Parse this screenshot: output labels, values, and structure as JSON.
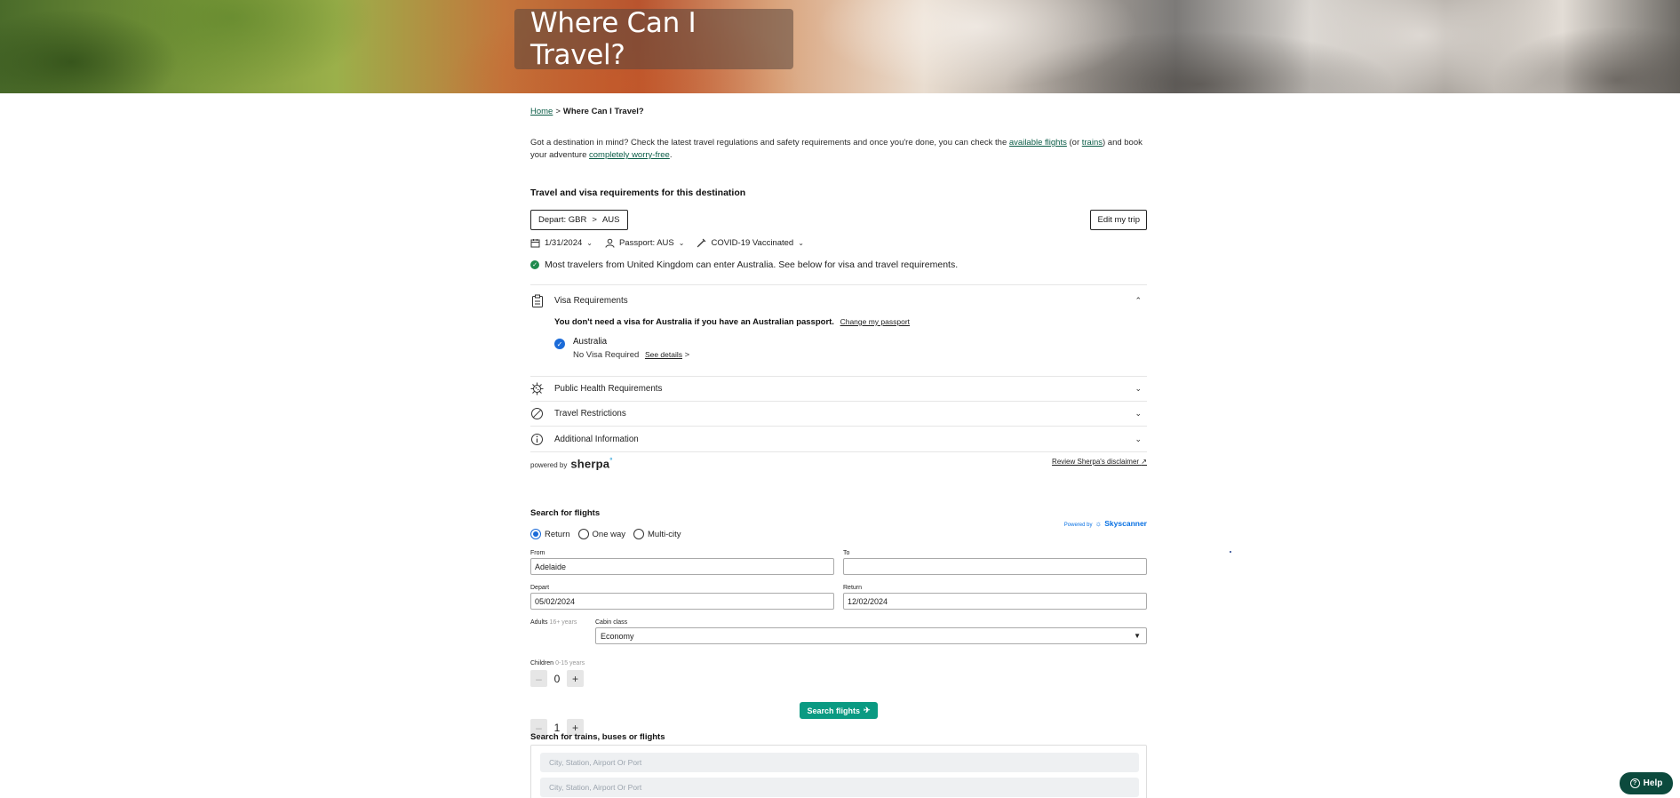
{
  "hero": {
    "title": "Where Can I Travel?"
  },
  "breadcrumb": {
    "home": "Home",
    "separator": ">",
    "current": "Where Can I Travel?"
  },
  "intro": {
    "part1": "Got a destination in mind? Check the latest travel regulations and safety requirements and once you're done, you can check the ",
    "link_flights": "available flights",
    "part2": " (or ",
    "link_trains": "trains",
    "part3": ") and book your adventure ",
    "link_worry": "completely worry-free",
    "part4": "."
  },
  "requirements": {
    "title": "Travel and visa requirements for this destination",
    "depart_label": "Depart: GBR",
    "depart_arrow": ">",
    "depart_dest": "AUS",
    "edit_trip": "Edit my trip",
    "date": "1/31/2024",
    "passport": "Passport: AUS",
    "vaccination": "COVID-19 Vaccinated",
    "status": "Most travelers from United Kingdom can enter Australia. See below for visa and travel requirements.",
    "sections": {
      "visa": "Visa Requirements",
      "health": "Public Health Requirements",
      "restrictions": "Travel Restrictions",
      "additional": "Additional Information"
    },
    "visa_note": "You don't need a visa for Australia if you have an Australian passport.",
    "change_passport": "Change my passport",
    "visa_country": "Australia",
    "visa_status": "No Visa Required",
    "see_details": "See details",
    "see_details_chev": ">",
    "powered_by": "powered by",
    "sherpa": "sherpa",
    "disclaimer": "Review Sherpa's disclaimer"
  },
  "flights": {
    "title": "Search for flights",
    "powered_by": "Powered by",
    "brand": "Skyscanner",
    "trip_types": [
      "Return",
      "One way",
      "Multi-city"
    ],
    "selected_trip_type": "Return",
    "from_label": "From",
    "from_value": "Adelaide",
    "to_label": "To",
    "to_value": "",
    "depart_label": "Depart",
    "depart_value": "05/02/2024",
    "return_label": "Return",
    "return_value": "12/02/2024",
    "adults_label": "Adults",
    "adults_hint": "16+ years",
    "adults_value": "1",
    "cabin_label": "Cabin class",
    "cabin_value": "Economy",
    "children_label": "Children",
    "children_hint": "0-15 years",
    "children_value": "0",
    "minus": "–",
    "plus": "+",
    "search_button": "Search flights"
  },
  "trains": {
    "title": "Search for trains, buses or flights",
    "placeholder_from": "City, Station, Airport Or Port",
    "placeholder_to": "City, Station, Airport Or Port"
  },
  "help": {
    "label": "Help"
  },
  "colors": {
    "accent_green": "#0a5c46",
    "button_teal": "#0a9a82",
    "check_blue": "#1b6bd8",
    "help_bg": "#0c4a3d"
  }
}
